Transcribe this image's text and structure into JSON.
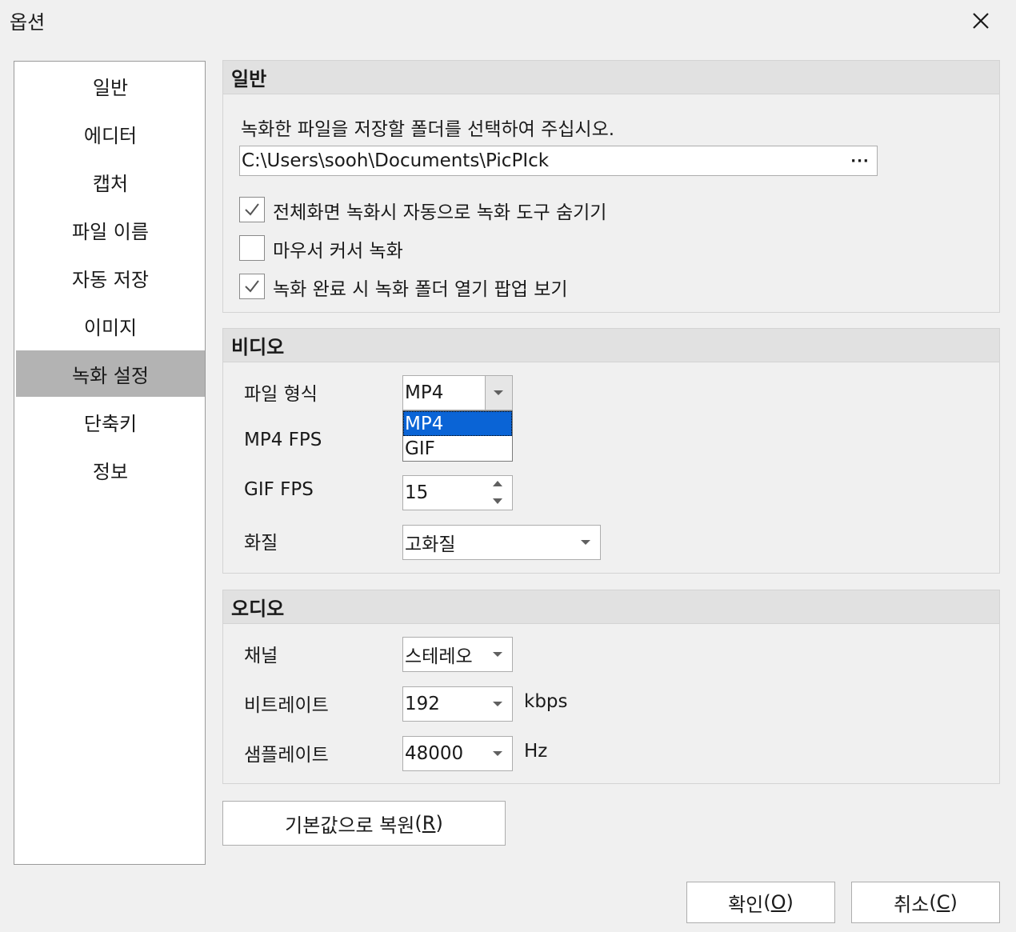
{
  "window": {
    "title": "옵션"
  },
  "sidebar": {
    "items": [
      {
        "label": "일반"
      },
      {
        "label": "에디터"
      },
      {
        "label": "캡처"
      },
      {
        "label": "파일 이름"
      },
      {
        "label": "자동 저장"
      },
      {
        "label": "이미지"
      },
      {
        "label": "녹화 설정",
        "selected": true
      },
      {
        "label": "단축키"
      },
      {
        "label": "정보"
      }
    ]
  },
  "general": {
    "heading": "일반",
    "folder_prompt": "녹화한 파일을 저장할 폴더를 선택하여 주십시오.",
    "folder_path": "C:\\Users\\sooh\\Documents\\PicPIck",
    "browse_label": "···",
    "options": [
      {
        "label": "전체화면 녹화시 자동으로 녹화 도구 숨기기",
        "checked": true
      },
      {
        "label": "마우서 커서 녹화",
        "checked": false
      },
      {
        "label": "녹화 완료 시 녹화 폴더 열기 팝업 보기",
        "checked": true
      }
    ]
  },
  "video": {
    "heading": "비디오",
    "format": {
      "label": "파일 형식",
      "value": "MP4",
      "options": [
        "MP4",
        "GIF"
      ],
      "highlighted": "MP4"
    },
    "mp4_fps": {
      "label": "MP4 FPS"
    },
    "gif_fps": {
      "label": "GIF FPS",
      "value": "15"
    },
    "quality": {
      "label": "화질",
      "value": "고화질"
    }
  },
  "audio": {
    "heading": "오디오",
    "channel": {
      "label": "채널",
      "value": "스테레오"
    },
    "bitrate": {
      "label": "비트레이트",
      "value": "192",
      "unit": "kbps"
    },
    "samplerate": {
      "label": "샘플레이트",
      "value": "48000",
      "unit": "Hz"
    }
  },
  "buttons": {
    "reset": {
      "label": "기본값으로 복원",
      "accel_open": "(",
      "accel_key": "R",
      "accel_close": ")"
    },
    "ok": {
      "label": "확인",
      "accel_open": "(",
      "accel_key": "O",
      "accel_close": ")"
    },
    "cancel": {
      "label": "취소",
      "accel_open": "(",
      "accel_key": "C",
      "accel_close": ")"
    }
  }
}
